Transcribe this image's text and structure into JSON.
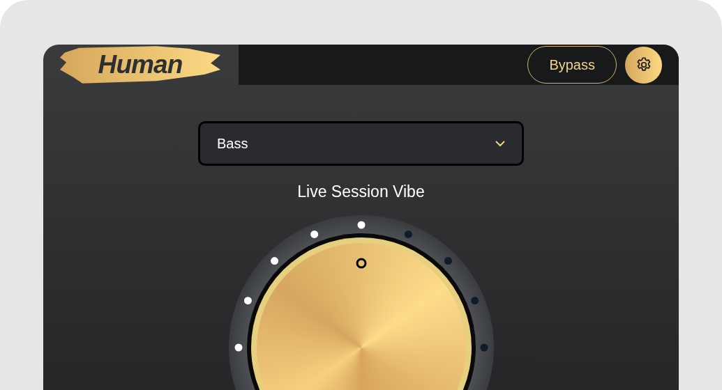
{
  "logo": {
    "text": "Human"
  },
  "header": {
    "bypass": {
      "label": "Bypass"
    }
  },
  "preset_dropdown": {
    "value": "Bass"
  },
  "knob": {
    "title": "Live Session Vibe",
    "level": 0.5
  }
}
